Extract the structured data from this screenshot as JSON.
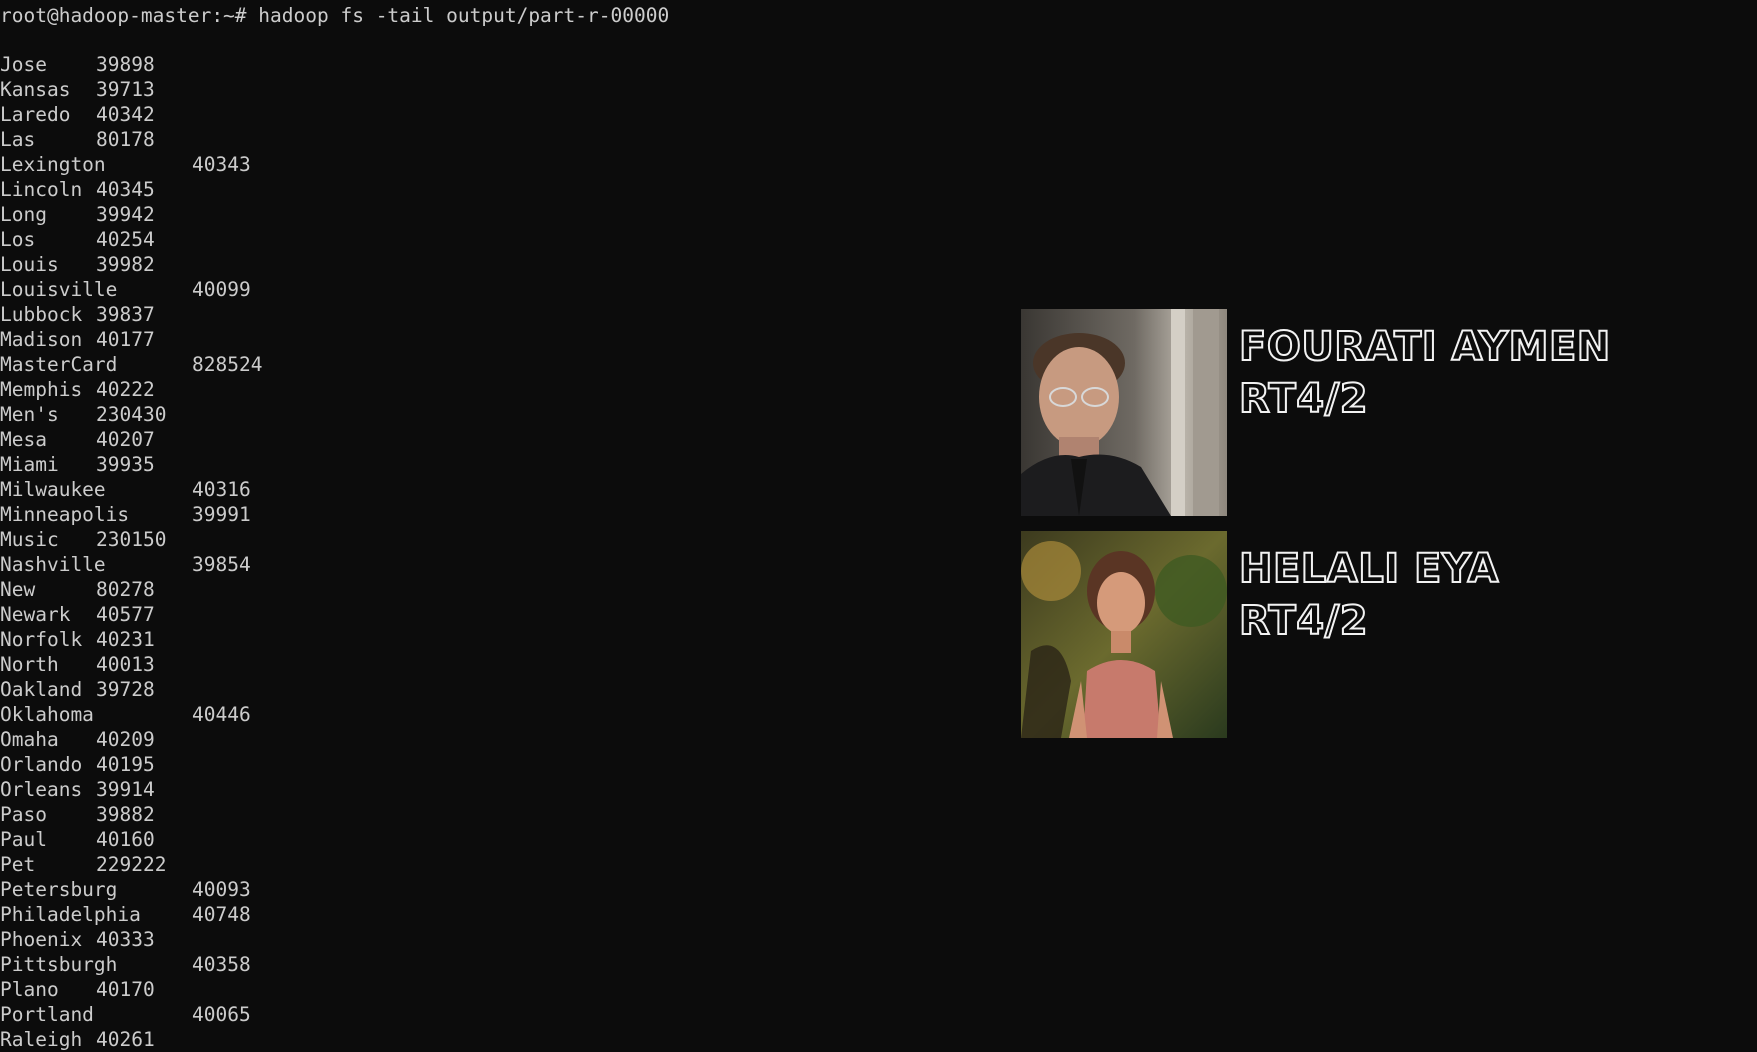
{
  "terminal": {
    "prompt": "root@hadoop-master:~#",
    "command": "hadoop fs -tail output/part-r-00000",
    "rows": [
      {
        "key": "Jose",
        "value": "39898"
      },
      {
        "key": "Kansas",
        "value": "39713"
      },
      {
        "key": "Laredo",
        "value": "40342"
      },
      {
        "key": "Las",
        "value": "80178"
      },
      {
        "key": "Lexington",
        "value": "40343"
      },
      {
        "key": "Lincoln",
        "value": "40345"
      },
      {
        "key": "Long",
        "value": "39942"
      },
      {
        "key": "Los",
        "value": "40254"
      },
      {
        "key": "Louis",
        "value": "39982"
      },
      {
        "key": "Louisville",
        "value": "40099"
      },
      {
        "key": "Lubbock",
        "value": "39837"
      },
      {
        "key": "Madison",
        "value": "40177"
      },
      {
        "key": "MasterCard",
        "value": "828524"
      },
      {
        "key": "Memphis",
        "value": "40222"
      },
      {
        "key": "Men's",
        "value": "230430"
      },
      {
        "key": "Mesa",
        "value": "40207"
      },
      {
        "key": "Miami",
        "value": "39935"
      },
      {
        "key": "Milwaukee",
        "value": "40316"
      },
      {
        "key": "Minneapolis",
        "value": "39991"
      },
      {
        "key": "Music",
        "value": "230150"
      },
      {
        "key": "Nashville",
        "value": "39854"
      },
      {
        "key": "New",
        "value": "80278"
      },
      {
        "key": "Newark",
        "value": "40577"
      },
      {
        "key": "Norfolk",
        "value": "40231"
      },
      {
        "key": "North",
        "value": "40013"
      },
      {
        "key": "Oakland",
        "value": "39728"
      },
      {
        "key": "Oklahoma",
        "value": "40446"
      },
      {
        "key": "Omaha",
        "value": "40209"
      },
      {
        "key": "Orlando",
        "value": "40195"
      },
      {
        "key": "Orleans",
        "value": "39914"
      },
      {
        "key": "Paso",
        "value": "39882"
      },
      {
        "key": "Paul",
        "value": "40160"
      },
      {
        "key": "Pet",
        "value": "229222"
      },
      {
        "key": "Petersburg",
        "value": "40093"
      },
      {
        "key": "Philadelphia",
        "value": "40748"
      },
      {
        "key": "Phoenix",
        "value": "40333"
      },
      {
        "key": "Pittsburgh",
        "value": "40358"
      },
      {
        "key": "Plano",
        "value": "40170"
      },
      {
        "key": "Portland",
        "value": "40065"
      },
      {
        "key": "Raleigh",
        "value": "40261"
      }
    ]
  },
  "overlay": {
    "people": [
      {
        "name": "FOURATI AYMEN",
        "group": "RT4/2"
      },
      {
        "name": "HELALI EYA",
        "group": "RT4/2"
      }
    ]
  }
}
